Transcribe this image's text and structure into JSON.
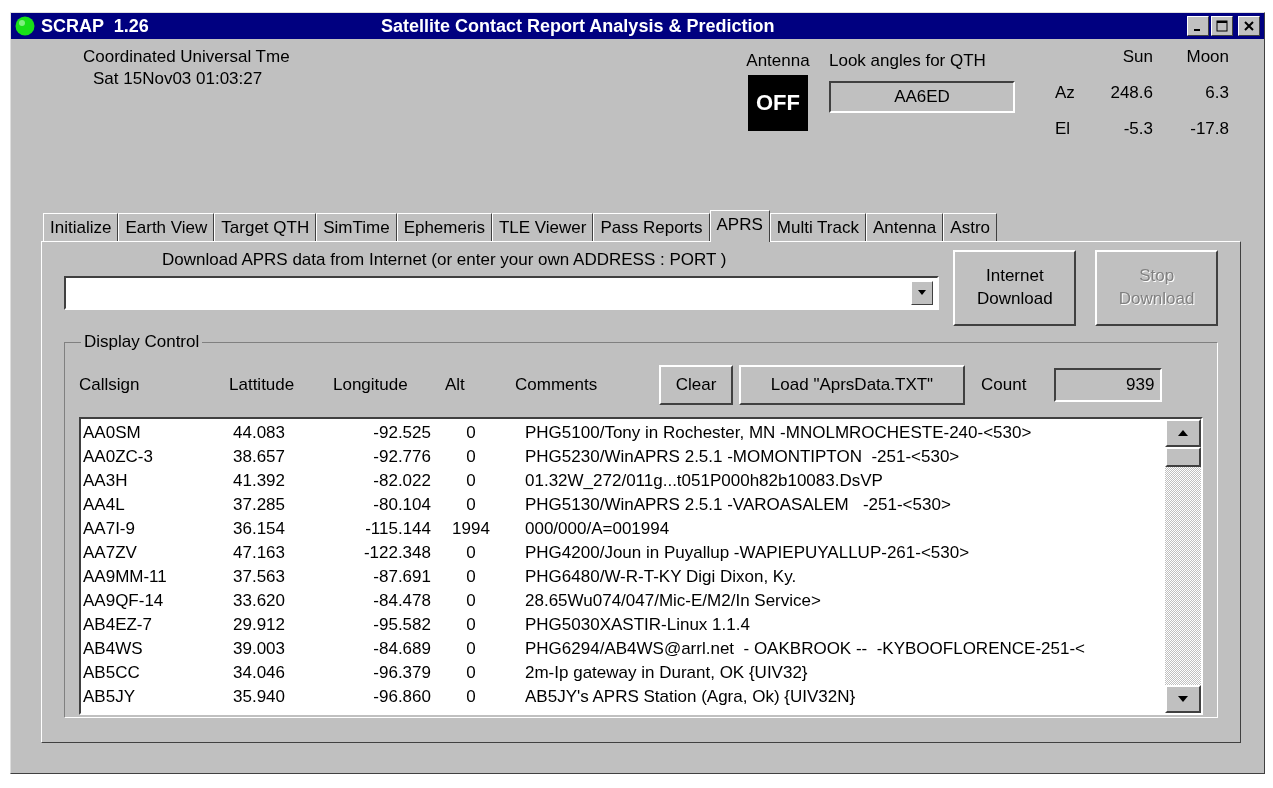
{
  "window": {
    "app_name": "SCRAP  1.26",
    "title": "Satellite Contact Report Analysis & Prediction"
  },
  "clock": {
    "label": "Coordinated Universal Tme",
    "value": "Sat 15Nov03 01:03:27"
  },
  "antenna": {
    "label": "Antenna",
    "status": "OFF"
  },
  "look_angles": {
    "label": "Look angles for QTH",
    "value": "AA6ED"
  },
  "sun_moon": {
    "columns": [
      "Sun",
      "Moon"
    ],
    "rows": [
      {
        "label": "Az",
        "sun": "248.6",
        "moon": "6.3"
      },
      {
        "label": "El",
        "sun": "-5.3",
        "moon": "-17.8"
      }
    ]
  },
  "tabs": [
    {
      "label": "Initialize",
      "selected": false
    },
    {
      "label": "Earth View",
      "selected": false
    },
    {
      "label": "Target QTH",
      "selected": false
    },
    {
      "label": "SimTime",
      "selected": false
    },
    {
      "label": "Ephemeris",
      "selected": false
    },
    {
      "label": "TLE Viewer",
      "selected": false
    },
    {
      "label": "Pass Reports",
      "selected": false
    },
    {
      "label": "APRS",
      "selected": true
    },
    {
      "label": "Multi Track",
      "selected": false
    },
    {
      "label": "Antenna",
      "selected": false
    },
    {
      "label": "Astro",
      "selected": false
    }
  ],
  "download": {
    "label": "Download APRS data from Internet (or enter your own ADDRESS : PORT )",
    "buttons": [
      {
        "label": "Internet Download",
        "disabled": false
      },
      {
        "label": "Stop Download",
        "disabled": true
      }
    ]
  },
  "display_control": {
    "title": "Display Control",
    "columns": [
      "Callsign",
      "Lattitude",
      "Longitude",
      "Alt",
      "Comments"
    ],
    "buttons": [
      {
        "label": "Clear"
      },
      {
        "label": "Load \"AprsData.TXT\""
      }
    ],
    "count_label": "Count",
    "count": "939",
    "rows": [
      {
        "callsign": "AA0SM",
        "lat": "44.083",
        "lon": "-92.525",
        "alt": "0",
        "comment": "PHG5100/Tony in Rochester, MN -MNOLMROCHESTE-240-<530>"
      },
      {
        "callsign": "AA0ZC-3",
        "lat": "38.657",
        "lon": "-92.776",
        "alt": "0",
        "comment": "PHG5230/WinAPRS 2.5.1 -MOMONTIPTON  -251-<530>"
      },
      {
        "callsign": "AA3H",
        "lat": "41.392",
        "lon": "-82.022",
        "alt": "0",
        "comment": "01.32W_272/011g...t051P000h82b10083.DsVP"
      },
      {
        "callsign": "AA4L",
        "lat": "37.285",
        "lon": "-80.104",
        "alt": "0",
        "comment": "PHG5130/WinAPRS 2.5.1 -VAROASALEM   -251-<530>"
      },
      {
        "callsign": "AA7I-9",
        "lat": "36.154",
        "lon": "-115.144",
        "alt": "1994",
        "comment": "000/000/A=001994"
      },
      {
        "callsign": "AA7ZV",
        "lat": "47.163",
        "lon": "-122.348",
        "alt": "0",
        "comment": "PHG4200/Joun in Puyallup -WAPIEPUYALLUP-261-<530>"
      },
      {
        "callsign": "AA9MM-11",
        "lat": "37.563",
        "lon": "-87.691",
        "alt": "0",
        "comment": "PHG6480/W-R-T-KY Digi Dixon, Ky."
      },
      {
        "callsign": "AA9QF-14",
        "lat": "33.620",
        "lon": "-84.478",
        "alt": "0",
        "comment": "28.65Wu074/047/Mic-E/M2/In Service>"
      },
      {
        "callsign": "AB4EZ-7",
        "lat": "29.912",
        "lon": "-95.582",
        "alt": "0",
        "comment": "PHG5030XASTIR-Linux 1.1.4"
      },
      {
        "callsign": "AB4WS",
        "lat": "39.003",
        "lon": "-84.689",
        "alt": "0",
        "comment": "PHG6294/AB4WS@arrl.net  - OAKBROOK --  -KYBOOFLORENCE-251-<"
      },
      {
        "callsign": "AB5CC",
        "lat": "34.046",
        "lon": "-96.379",
        "alt": "0",
        "comment": "2m-Ip gateway in Durant, OK {UIV32}"
      },
      {
        "callsign": "AB5JY",
        "lat": "35.940",
        "lon": "-96.860",
        "alt": "0",
        "comment": "AB5JY's APRS Station (Agra, Ok) {UIV32N}"
      }
    ]
  }
}
